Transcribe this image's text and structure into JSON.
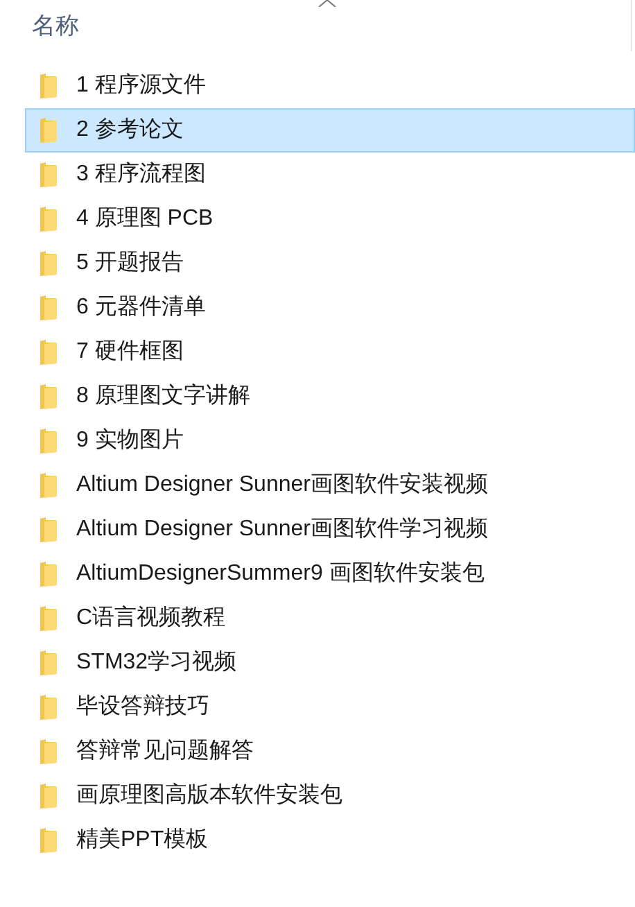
{
  "header": {
    "label": "名称"
  },
  "items": [
    {
      "name": "1 程序源文件",
      "selected": false
    },
    {
      "name": "2 参考论文",
      "selected": true
    },
    {
      "name": "3 程序流程图",
      "selected": false
    },
    {
      "name": "4 原理图 PCB",
      "selected": false
    },
    {
      "name": "5 开题报告",
      "selected": false
    },
    {
      "name": "6 元器件清单",
      "selected": false
    },
    {
      "name": "7 硬件框图",
      "selected": false
    },
    {
      "name": "8 原理图文字讲解",
      "selected": false
    },
    {
      "name": "9 实物图片",
      "selected": false
    },
    {
      "name": "Altium Designer Sunner画图软件安装视频",
      "selected": false
    },
    {
      "name": "Altium Designer Sunner画图软件学习视频",
      "selected": false
    },
    {
      "name": "AltiumDesignerSummer9 画图软件安装包",
      "selected": false
    },
    {
      "name": "C语言视频教程",
      "selected": false
    },
    {
      "name": "STM32学习视频",
      "selected": false
    },
    {
      "name": "毕设答辩技巧",
      "selected": false
    },
    {
      "name": "答辩常见问题解答",
      "selected": false
    },
    {
      "name": "画原理图高版本软件安装包",
      "selected": false
    },
    {
      "name": "精美PPT模板",
      "selected": false
    }
  ]
}
